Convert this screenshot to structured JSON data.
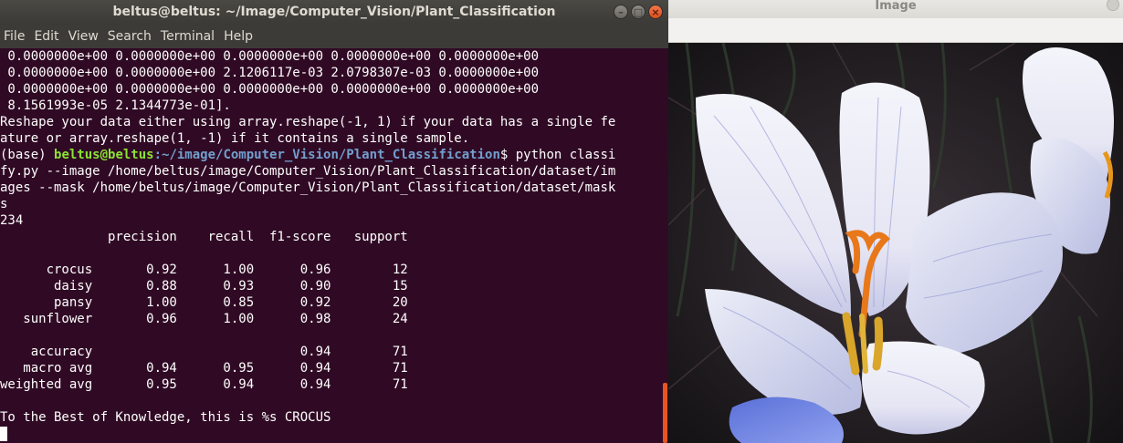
{
  "terminal": {
    "title": "beltus@beltus: ~/Image/Computer_Vision/Plant_Classification",
    "menu": [
      "File",
      "Edit",
      "View",
      "Search",
      "Terminal",
      "Help"
    ],
    "pre_lines": [
      " 0.0000000e+00 0.0000000e+00 0.0000000e+00 0.0000000e+00 0.0000000e+00",
      " 0.0000000e+00 0.0000000e+00 2.1206117e-03 2.0798307e-03 0.0000000e+00",
      " 0.0000000e+00 0.0000000e+00 0.0000000e+00 0.0000000e+00 0.0000000e+00",
      " 8.1561993e-05 2.1344773e-01].",
      "Reshape your data either using array.reshape(-1, 1) if your data has a single fe",
      "ature or array.reshape(1, -1) if it contains a single sample."
    ],
    "prompt": {
      "env": "(base) ",
      "user_host": "beltus@beltus",
      "path": ":~/image/Computer_Vision/Plant_Classification",
      "symbol": "$ ",
      "command_first": "python classi"
    },
    "cmd_lines": [
      "fy.py --image /home/beltus/image/Computer_Vision/Plant_Classification/dataset/im",
      "ages --mask /home/beltus/image/Computer_Vision/Plant_Classification/dataset/mask",
      "s",
      "234"
    ],
    "report_lines": [
      "              precision    recall  f1-score   support",
      "",
      "      crocus       0.92      1.00      0.96        12",
      "       daisy       0.88      0.93      0.90        15",
      "       pansy       1.00      0.85      0.92        20",
      "   sunflower       0.96      1.00      0.98        24",
      "",
      "    accuracy                           0.94        71",
      "   macro avg       0.94      0.95      0.94        71",
      "weighted avg       0.95      0.94      0.94        71",
      "",
      "To the Best of Knowledge, this is %s CROCUS"
    ]
  },
  "image_window": {
    "title": "Image",
    "subject": "crocus flower"
  }
}
